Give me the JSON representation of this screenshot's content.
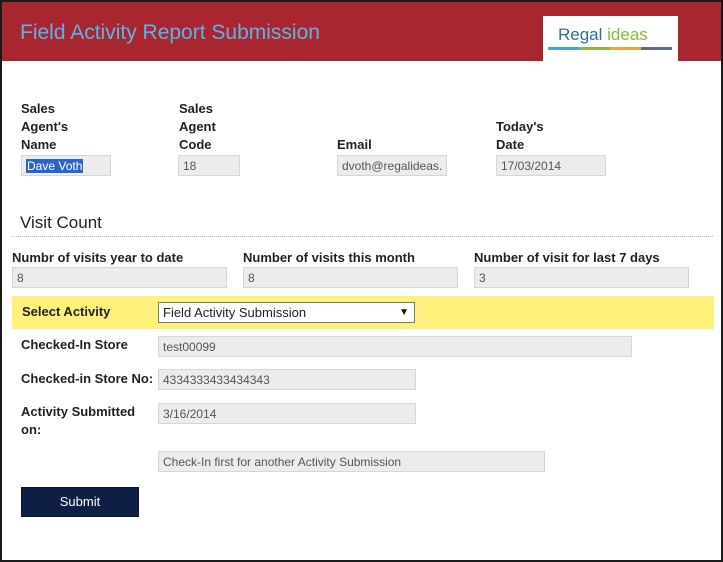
{
  "header": {
    "title": "Field Activity Report Submission",
    "logo": {
      "word1": "Regal",
      "word2": "ideas"
    },
    "colors": {
      "band": "#a8262f",
      "title": "#5ab4e6",
      "logo_bars": [
        "#4aa3d8",
        "#8bb83b",
        "#f2a33a",
        "#5a6a8a"
      ]
    }
  },
  "agent": {
    "name_label_1": "Sales",
    "name_label_2": "Agent's",
    "name_label_3": "Name",
    "name_value": "Dave Voth",
    "code_label_1": "Sales",
    "code_label_2": "Agent",
    "code_label_3": "Code",
    "code_value": "18",
    "email_label": "Email",
    "email_value": "dvoth@regalideas.",
    "date_label_1": "Today's",
    "date_label_2": "Date",
    "date_value": "17/03/2014"
  },
  "visits": {
    "section_title": "Visit Count",
    "ytd_label": "Numbr of visits year to date",
    "ytd_value": "8",
    "month_label": "Number of visits this month",
    "month_value": "8",
    "week_label": "Number of visit for last 7 days",
    "week_value": "3"
  },
  "activity": {
    "select_label": "Select Activity",
    "selected": "Field Activity Submission",
    "store_label": "Checked-In Store",
    "store_value": "test00099",
    "store_no_label": "Checked-in Store No:",
    "store_no_value": "4334333433434343",
    "submitted_label_1": "Activity Submitted",
    "submitted_label_2": "on:",
    "submitted_value": "3/16/2014",
    "notice": "Check-In first for another Activity Submission",
    "submit_label": "Submit"
  }
}
